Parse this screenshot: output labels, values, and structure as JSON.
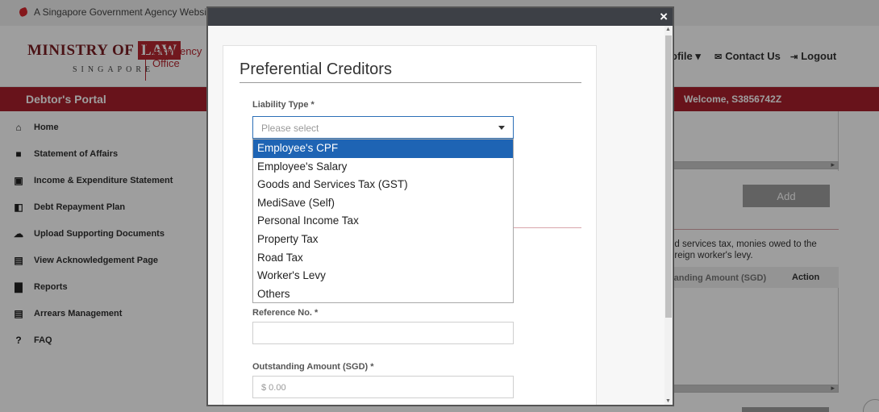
{
  "gov_bar": {
    "text": "A Singapore Government Agency Websit"
  },
  "logo": {
    "ministry": "MINISTRY OF",
    "law": "LAW",
    "singapore": "SINGAPORE",
    "office_line1": "Insolvency",
    "office_line2": "Office"
  },
  "top_nav": {
    "profile": "ofile ▾",
    "contact": "Contact Us",
    "logout": "Logout"
  },
  "portal": {
    "title": "Debtor's Portal",
    "welcome": "Welcome, S3856742Z"
  },
  "sidebar": {
    "items": [
      {
        "label": "Home",
        "icon": "home-icon"
      },
      {
        "label": "Statement of Affairs",
        "icon": "document-icon"
      },
      {
        "label": "Income & Expenditure Statement",
        "icon": "ledger-icon"
      },
      {
        "label": "Debt Repayment Plan",
        "icon": "plan-icon"
      },
      {
        "label": "Upload Supporting Documents",
        "icon": "upload-cloud-icon"
      },
      {
        "label": "View Acknowledgement Page",
        "icon": "acknowledgement-icon"
      },
      {
        "label": "Reports",
        "icon": "reports-icon"
      },
      {
        "label": "Arrears Management",
        "icon": "arrears-icon"
      },
      {
        "label": "FAQ",
        "icon": "question-icon"
      }
    ]
  },
  "background_content": {
    "add_button": "Add",
    "note_line1": "nd services tax, monies owed to the",
    "note_line2": "oreign worker's levy.",
    "table_col_amount": "tanding Amount (SGD)",
    "table_col_action": "Action"
  },
  "modal": {
    "close": "×",
    "title": "Preferential Creditors",
    "liability_label": "Liability Type *",
    "liability_placeholder": "Please select",
    "options": [
      "Employee's CPF",
      "Employee's Salary",
      "Goods and Services Tax (GST)",
      "MediSave (Self)",
      "Personal Income Tax",
      "Property Tax",
      "Road Tax",
      "Worker's Levy",
      "Others"
    ],
    "selected_index": 0,
    "reference_label": "Reference No. *",
    "reference_value": "",
    "amount_label": "Outstanding Amount (SGD) *",
    "amount_placeholder": "$ 0.00"
  },
  "colors": {
    "brand_red": "#a81f2c",
    "selected_blue": "#1e64b4",
    "modal_header": "#3d4046"
  }
}
